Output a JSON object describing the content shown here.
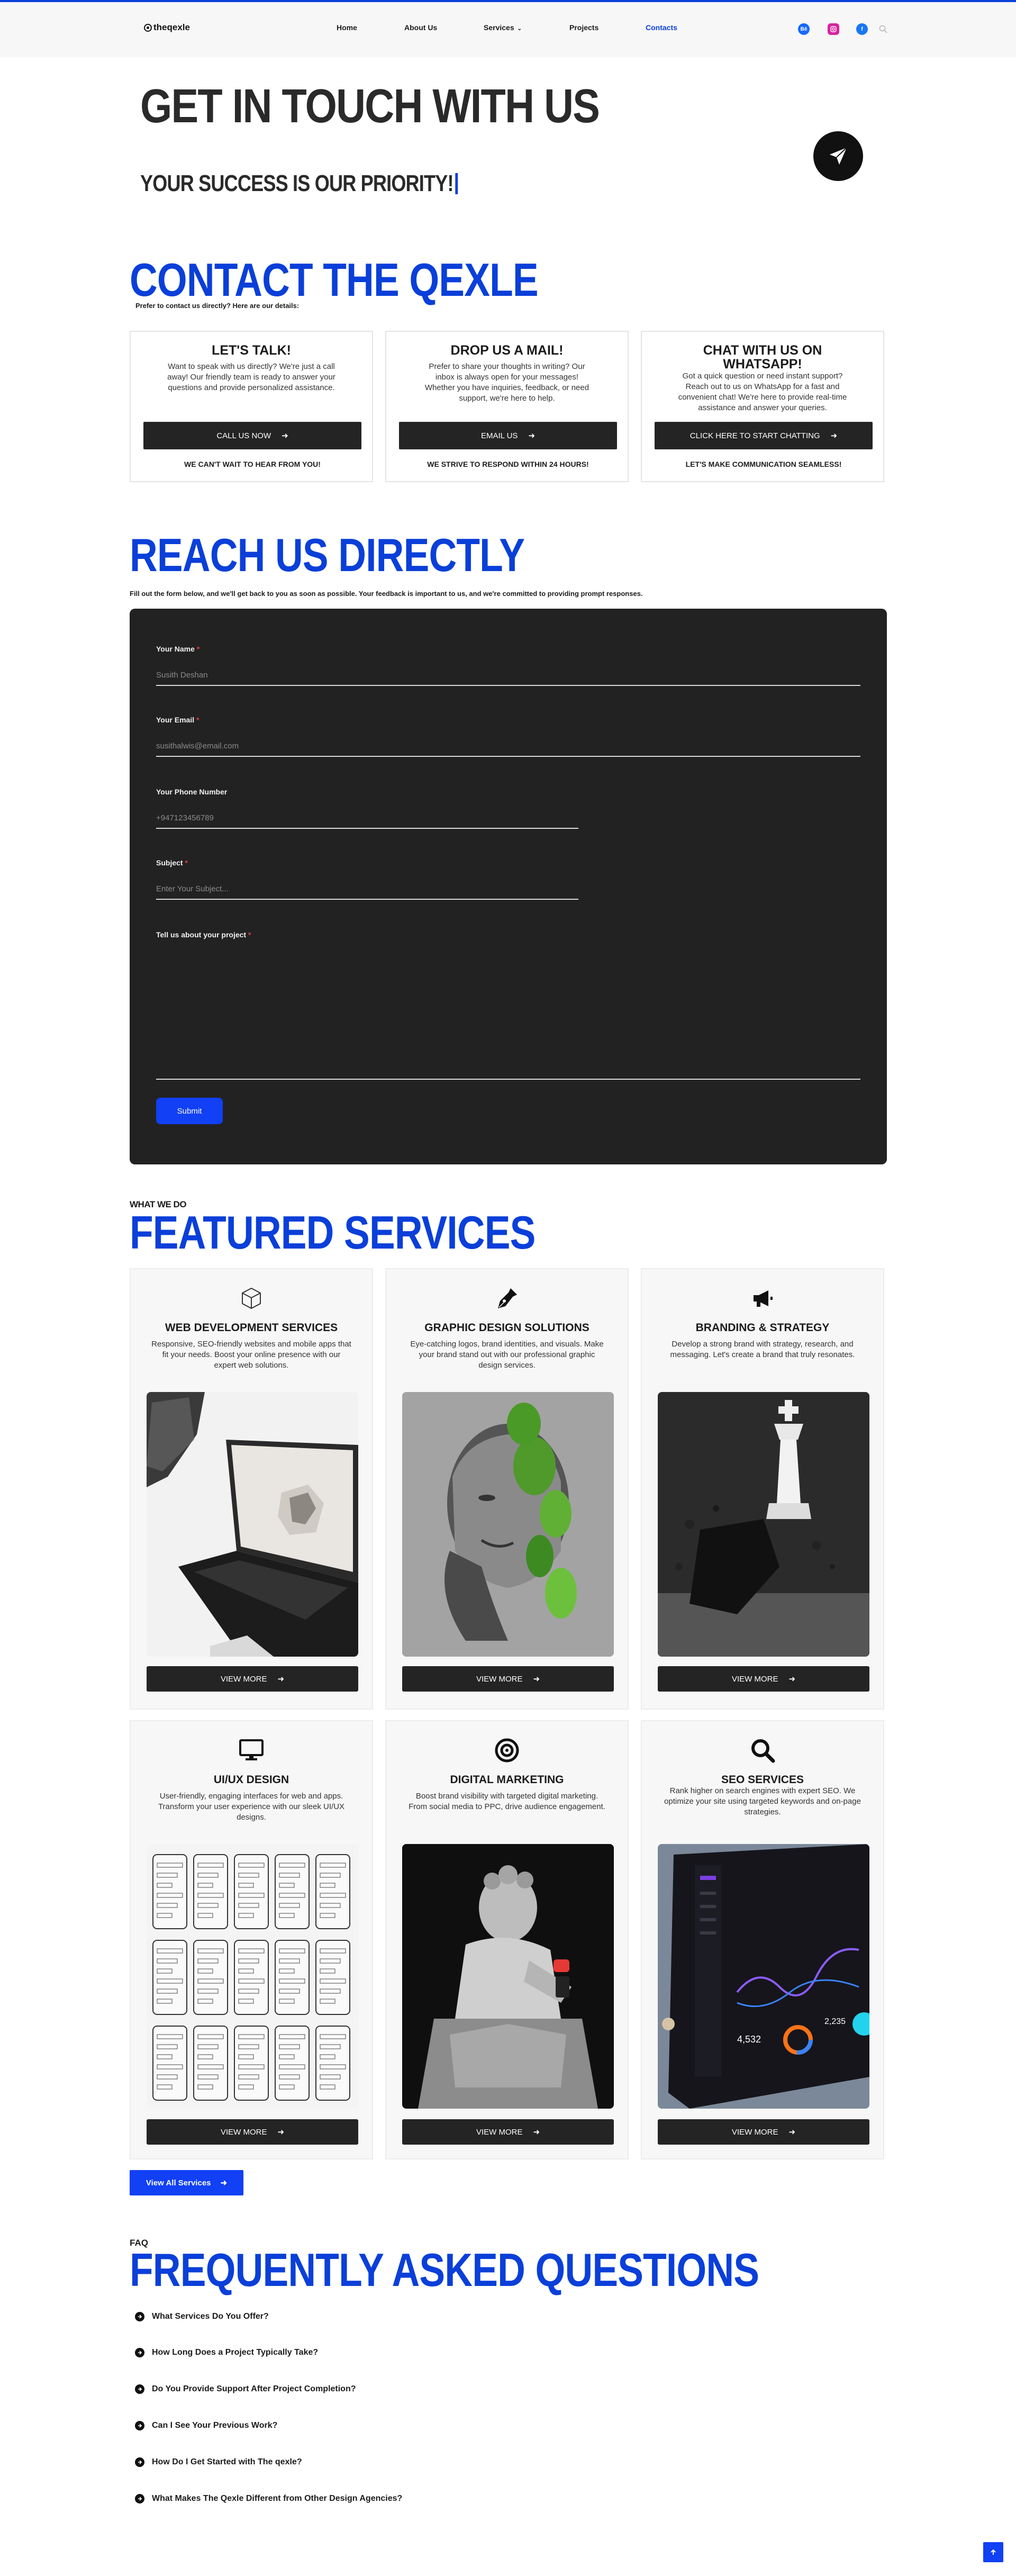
{
  "brand": {
    "logo": "theqexle"
  },
  "nav": {
    "items": [
      {
        "label": "Home"
      },
      {
        "label": "About Us"
      },
      {
        "label": "Services"
      },
      {
        "label": "Projects"
      },
      {
        "label": "Contacts"
      }
    ],
    "active": "Contacts",
    "social": [
      "behance-icon",
      "instagram-icon",
      "facebook-icon",
      "search-icon"
    ]
  },
  "hero": {
    "title": "GET IN TOUCH WITH US",
    "subtitle": "YOUR SUCCESS IS OUR PRIORITY!"
  },
  "contact": {
    "title": "CONTACT THE QEXLE",
    "intro": "Prefer to contact us directly? Here are our details:",
    "cards": [
      {
        "title": "LET'S TALK!",
        "text": "Want to speak with us directly? We're just a call away! Our friendly team is ready to answer your questions and provide personalized assistance.",
        "button": "CALL US NOW",
        "note": "WE CAN'T WAIT TO HEAR FROM YOU!"
      },
      {
        "title": "DROP US A MAIL!",
        "text": "Prefer to share your thoughts in writing? Our inbox is always open for your messages! Whether you have inquiries, feedback, or need support, we're here to help.",
        "button": "EMAIL US",
        "note": "WE STRIVE TO RESPOND WITHIN 24 HOURS!"
      },
      {
        "title": "CHAT WITH US ON WHATSAPP!",
        "text": "Got a quick question or need instant support? Reach out to us on WhatsApp for a fast and convenient chat! We're here to provide real-time assistance and answer your queries.",
        "button": "CLICK HERE TO START CHATTING",
        "note": "LET'S MAKE COMMUNICATION SEAMLESS!"
      }
    ]
  },
  "reach": {
    "title": "REACH US DIRECTLY",
    "intro": "Fill out the form below, and we'll get back to you as soon as possible. Your feedback is important to us, and we're committed to providing prompt responses.",
    "form": {
      "name_label": "Your Name",
      "name_placeholder": "Susith Deshan",
      "email_label": "Your Email",
      "email_placeholder": "susithalwis@email.com",
      "phone_label": "Your Phone Number",
      "phone_placeholder": "+94712345678­9",
      "subject_label": "Subject",
      "subject_placeholder": "Enter Your Subject...",
      "project_label": "Tell us about your project",
      "submit": "Submit"
    }
  },
  "services": {
    "kicker": "WHAT WE DO",
    "title": "FEATURED SERVICES",
    "items": [
      {
        "title": "WEB DEVELOPMENT SERVICES",
        "text": "Responsive, SEO-friendly websites and mobile apps that fit your needs. Boost your online presence with our expert web solutions.",
        "icon": "cube-icon",
        "button": "VIEW MORE"
      },
      {
        "title": "GRAPHIC DESIGN SOLUTIONS",
        "text": "Eye-catching logos, brand identities, and visuals. Make your brand stand out with our professional graphic design services.",
        "icon": "pen-nib-icon",
        "button": "VIEW MORE"
      },
      {
        "title": "BRANDING & STRATEGY",
        "text": "Develop a strong brand with strategy, research, and messaging. Let's create a brand that truly resonates.",
        "icon": "megaphone-icon",
        "button": "VIEW MORE"
      },
      {
        "title": "UI/UX DESIGN",
        "text": "User-friendly, engaging interfaces for web and apps. Transform your user experience with our sleek UI/UX designs.",
        "icon": "monitor-icon",
        "button": "VIEW MORE"
      },
      {
        "title": "DIGITAL MARKETING",
        "text": "Boost brand visibility with targeted digital marketing. From social media to PPC, drive audience engagement.",
        "icon": "target-icon",
        "button": "VIEW MORE"
      },
      {
        "title": "SEO SERVICES",
        "text": "Rank higher on search engines with expert SEO. We optimize your site using targeted keywords and on-page strategies.",
        "icon": "search-icon",
        "button": "VIEW MORE"
      }
    ],
    "view_all": "View All Services",
    "dashboard": {
      "value_a": "4,532",
      "value_b": "2,235"
    }
  },
  "faq": {
    "kicker": "FAQ",
    "title": "FREQUENTLY ASKED QUESTIONS",
    "items": [
      "What Services Do You Offer?",
      "How Long Does a Project Typically Take?",
      "Do You Provide Support After Project Completion?",
      "Can I See Your Previous Work?",
      "How Do I Get Started with The qexle?",
      "What Makes The Qexle Different from Other Design Agencies?"
    ]
  },
  "colors": {
    "accent": "#0a3fd9",
    "button_blue": "#1140f5",
    "dark": "#222222"
  }
}
